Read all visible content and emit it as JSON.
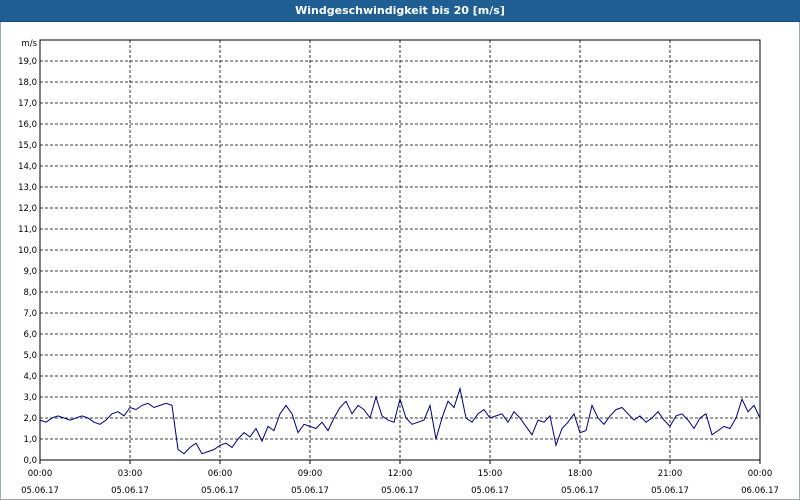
{
  "window": {
    "title": "Windgeschwindigkeit bis 20 [m/s]"
  },
  "chart_data": {
    "type": "line",
    "title": "Windgeschwindigkeit bis 20 [m/s]",
    "ylabel": "m/s",
    "ylim": [
      0,
      20
    ],
    "yticks": [
      "0,0",
      "1,0",
      "2,0",
      "3,0",
      "4,0",
      "5,0",
      "6,0",
      "7,0",
      "8,0",
      "9,0",
      "10,0",
      "11,0",
      "12,0",
      "13,0",
      "14,0",
      "15,0",
      "16,0",
      "17,0",
      "18,0",
      "19,0"
    ],
    "xlim_hours": [
      0,
      24
    ],
    "xticks": [
      {
        "time": "00:00",
        "date": "05.06.17"
      },
      {
        "time": "03:00",
        "date": "05.06.17"
      },
      {
        "time": "06:00",
        "date": "05.06.17"
      },
      {
        "time": "09:00",
        "date": "05.06.17"
      },
      {
        "time": "12:00",
        "date": "05.06.17"
      },
      {
        "time": "15:00",
        "date": "05.06.17"
      },
      {
        "time": "18:00",
        "date": "05.06.17"
      },
      {
        "time": "21:00",
        "date": "05.06.17"
      },
      {
        "time": "00:00",
        "date": "06.06.17"
      }
    ],
    "grid": true,
    "line_color": "#000080",
    "series": [
      {
        "x": [
          0,
          0.2,
          0.4,
          0.6,
          0.8,
          1,
          1.2,
          1.4,
          1.6,
          1.8,
          2,
          2.2,
          2.4,
          2.6,
          2.8,
          3,
          3.2,
          3.4,
          3.6,
          3.8,
          4,
          4.2,
          4.4,
          4.6,
          4.8,
          5,
          5.2,
          5.4,
          5.6,
          5.8,
          6,
          6.2,
          6.4,
          6.6,
          6.8,
          7,
          7.2,
          7.4,
          7.6,
          7.8,
          8,
          8.2,
          8.4,
          8.6,
          8.8,
          9,
          9.2,
          9.4,
          9.6,
          9.8,
          10,
          10.2,
          10.4,
          10.6,
          10.8,
          11,
          11.2,
          11.4,
          11.6,
          11.8,
          12,
          12.2,
          12.4,
          12.6,
          12.8,
          13,
          13.2,
          13.4,
          13.6,
          13.8,
          14,
          14.2,
          14.4,
          14.6,
          14.8,
          15,
          15.2,
          15.4,
          15.6,
          15.8,
          16,
          16.2,
          16.4,
          16.6,
          16.8,
          17,
          17.2,
          17.4,
          17.6,
          17.8,
          18,
          18.2,
          18.4,
          18.6,
          18.8,
          19,
          19.2,
          19.4,
          19.6,
          19.8,
          20,
          20.2,
          20.4,
          20.6,
          20.8,
          21,
          21.2,
          21.4,
          21.6,
          21.8,
          22,
          22.2,
          22.4,
          22.6,
          22.8,
          23,
          23.2,
          23.4,
          23.6,
          23.8,
          24
        ],
        "y": [
          1.9,
          1.8,
          2.0,
          2.1,
          2.0,
          1.9,
          2.0,
          2.1,
          2.0,
          1.8,
          1.7,
          1.9,
          2.2,
          2.3,
          2.1,
          2.5,
          2.4,
          2.6,
          2.7,
          2.5,
          2.6,
          2.7,
          2.6,
          0.5,
          0.3,
          0.6,
          0.8,
          0.3,
          0.4,
          0.5,
          0.7,
          0.8,
          0.6,
          1.0,
          1.3,
          1.1,
          1.5,
          0.9,
          1.6,
          1.4,
          2.2,
          2.6,
          2.2,
          1.3,
          1.7,
          1.6,
          1.5,
          1.8,
          1.4,
          2.0,
          2.5,
          2.8,
          2.2,
          2.6,
          2.4,
          2.0,
          3.0,
          2.1,
          1.9,
          1.8,
          2.9,
          2.0,
          1.7,
          1.8,
          1.9,
          2.6,
          1.0,
          2.0,
          2.8,
          2.5,
          3.4,
          2.0,
          1.8,
          2.2,
          2.4,
          2.0,
          2.1,
          2.2,
          1.8,
          2.3,
          2.0,
          1.6,
          1.2,
          1.9,
          1.8,
          2.1,
          0.7,
          1.5,
          1.8,
          2.2,
          1.3,
          1.4,
          2.6,
          2.0,
          1.7,
          2.1,
          2.4,
          2.5,
          2.2,
          1.9,
          2.1,
          1.8,
          2.0,
          2.3,
          1.9,
          1.6,
          2.1,
          2.2,
          1.9,
          1.5,
          2.0,
          2.2,
          1.2,
          1.4,
          1.6,
          1.5,
          2.0,
          2.9,
          2.3,
          2.6,
          2.0
        ]
      }
    ]
  }
}
